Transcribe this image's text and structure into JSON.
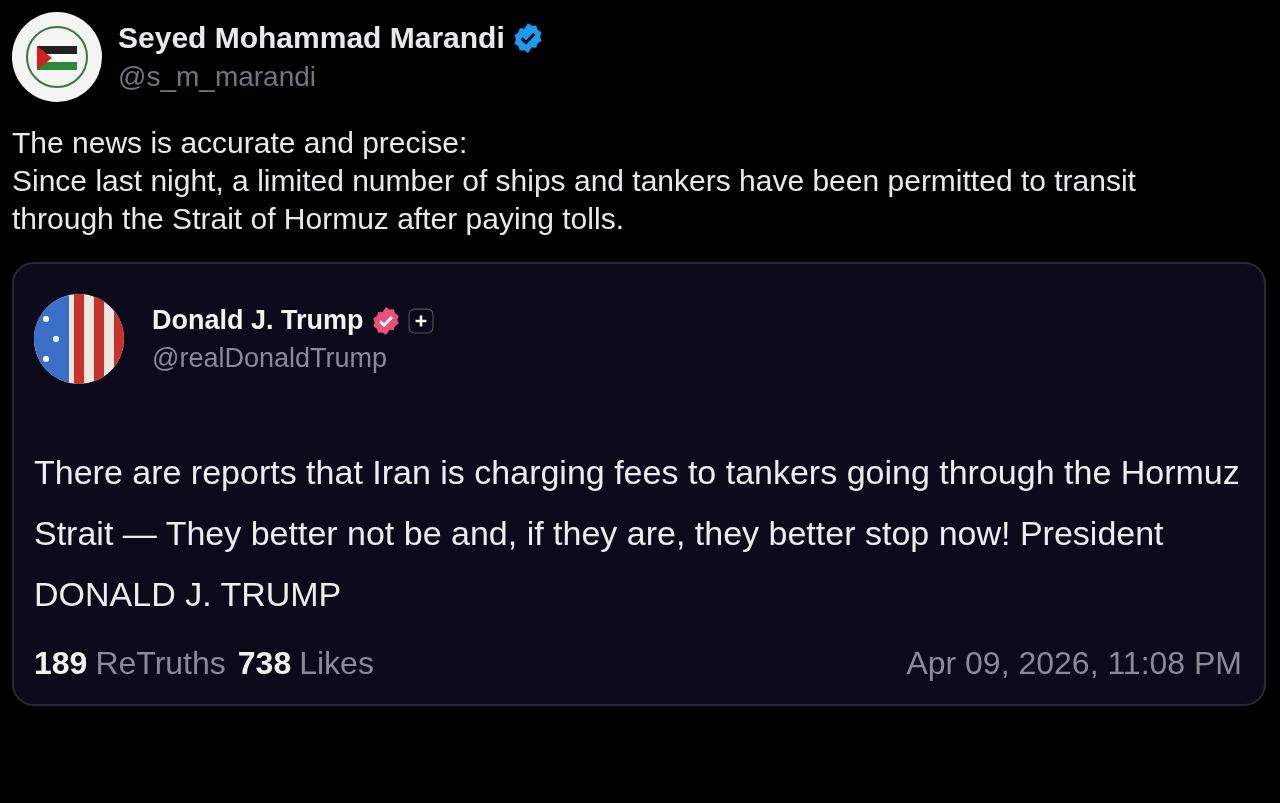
{
  "post": {
    "author": "Seyed Mohammad Marandi",
    "handle": "@s_m_marandi",
    "verified": true,
    "text_lines": [
      "The news is accurate and precise:",
      "Since last night, a limited number of ships and tankers have been permitted to transit through the Strait of Hormuz after paying tolls."
    ]
  },
  "quoted_post": {
    "author": "Donald J. Trump",
    "handle": "@realDonaldTrump",
    "verified": true,
    "text": "There are reports that Iran is charging fees to tankers going through the Hormuz Strait — They better not be and, if they are, they better stop now! President DONALD J. TRUMP",
    "stats": [
      {
        "count": "189",
        "label": "ReTruths"
      },
      {
        "count": "738",
        "label": "Likes"
      }
    ],
    "timestamp": "Apr 09, 2026, 11:08 PM"
  }
}
